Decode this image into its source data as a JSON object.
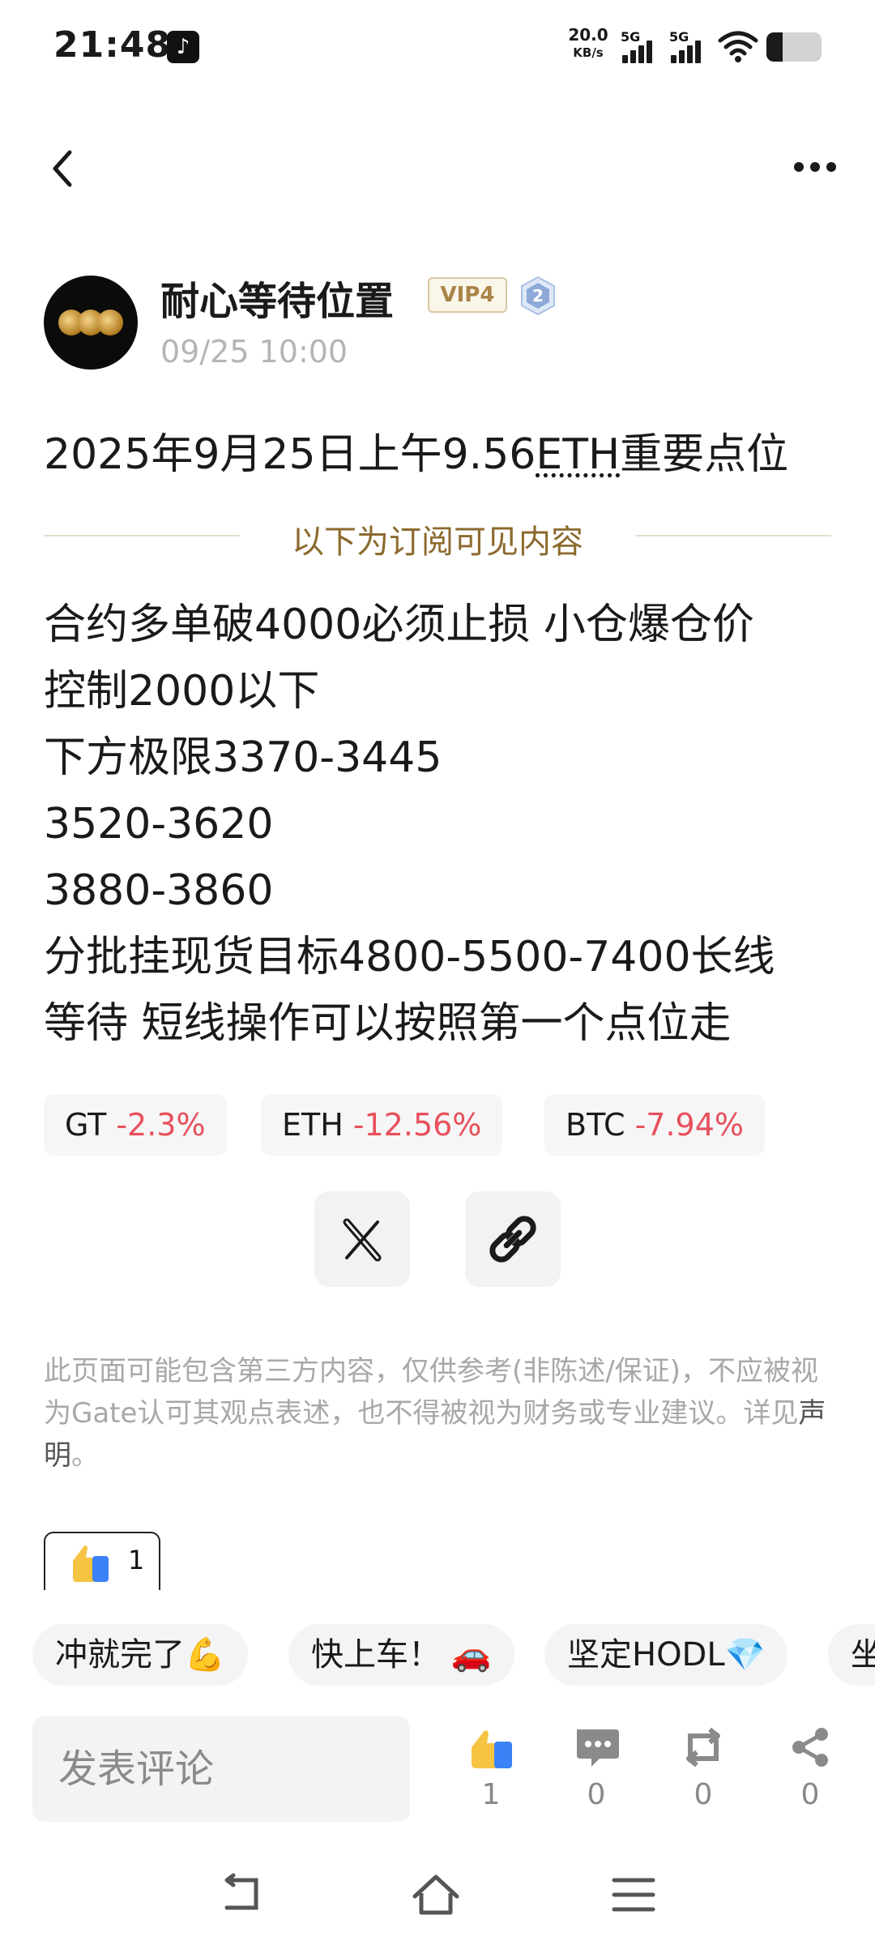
{
  "status_bar": {
    "time": "21:48",
    "net_speed_value": "20.0",
    "net_speed_unit": "KB/s",
    "signal1_label": "5G",
    "signal2_label": "5G",
    "battery_level": 0.3
  },
  "post": {
    "author": "耐心等待位置",
    "vip_label": "VIP4",
    "level": "2",
    "time": "09/25 10:00",
    "title_prefix": "2025年9月25日上午9.56",
    "title_link": "ETH",
    "title_suffix": "重要点位",
    "subscriber_divider": "以下为订阅可见内容",
    "body_lines": [
      "合约多单破4000必须止损 小仓爆仓价",
      "控制2000以下",
      "下方极限3370-3445",
      "3520-3620",
      "3880-3860",
      "分批挂现货目标4800-5500-7400长线",
      "等待 短线操作可以按照第一个点位走"
    ]
  },
  "tickers": [
    {
      "symbol": "GT",
      "change": "-2.3%"
    },
    {
      "symbol": "ETH",
      "change": "-12.56%"
    },
    {
      "symbol": "BTC",
      "change": "-7.94%"
    }
  ],
  "disclaimer": {
    "text": "此页面可能包含第三方内容，仅供参考(非陈述/保证)，不应被视为Gate认可其观点表述，也不得被视为财务或专业建议。详见",
    "link": "声明",
    "end": "。"
  },
  "reaction": {
    "count": "1"
  },
  "quick_comments": [
    "冲就完了💪",
    "快上车！ 🚗",
    "坚定HODL💎",
    "坐"
  ],
  "bottom_bar": {
    "comment_placeholder": "发表评论",
    "like_count": "1",
    "comment_count": "0",
    "repost_count": "0",
    "share_count": "0"
  },
  "icons": {
    "back": "back-arrow-icon",
    "more": "more-icon",
    "x_share": "x-logo-icon",
    "copy_link": "link-icon",
    "like": "thumbs-up-icon",
    "comment": "comment-icon",
    "repost": "repost-icon",
    "share": "share-icon"
  },
  "colors": {
    "negative": "#e8505b",
    "gold": "#8c6a2e",
    "like_yellow": "#f6c343",
    "like_blue": "#3b82f6"
  }
}
